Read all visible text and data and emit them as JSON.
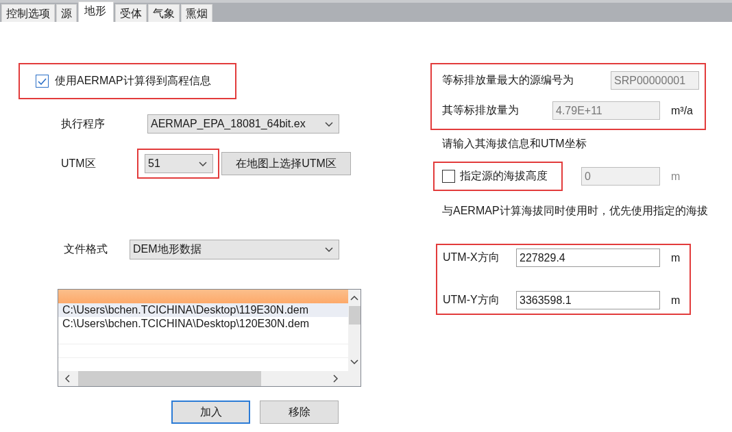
{
  "tabs": [
    {
      "label": "控制选项",
      "selected": false
    },
    {
      "label": "源",
      "selected": false
    },
    {
      "label": "地形",
      "selected": true
    },
    {
      "label": "受体",
      "selected": false
    },
    {
      "label": "气象",
      "selected": false
    },
    {
      "label": "熏烟",
      "selected": false
    }
  ],
  "use_aermap": {
    "label": "使用AERMAP计算得到高程信息",
    "checked": true,
    "highlighted": true
  },
  "executable": {
    "label": "执行程序",
    "value": "AERMAP_EPA_18081_64bit.ex"
  },
  "utm_zone": {
    "label": "UTM区",
    "value": "51",
    "highlighted": true,
    "button": "在地图上选择UTM区"
  },
  "file_format": {
    "label": "文件格式",
    "value": "DEM地形数据"
  },
  "file_list": {
    "rows": [
      {
        "path": "C:\\Users\\bchen.TCICHINA\\Desktop\\119E30N.dem",
        "selected": true
      },
      {
        "path": "C:\\Users\\bchen.TCICHINA\\Desktop\\120E30N.dem",
        "selected": false
      }
    ]
  },
  "list_buttons": [
    {
      "label": "加入",
      "focused": true
    },
    {
      "label": "移除",
      "focused": false
    }
  ],
  "source_info": {
    "highlighted": true,
    "rows": [
      {
        "label": "等标排放量最大的源编号为",
        "value": "SRP00000001"
      },
      {
        "label": "其等标排放量为",
        "value": "4.79E+11",
        "unit": "m³/a"
      }
    ]
  },
  "prompt": "请输入其海拔信息和UTM坐标",
  "specify_elevation": {
    "label": "指定源的海拔高度",
    "checked": false,
    "highlighted": true,
    "value": "0",
    "unit": "m",
    "disabled": true
  },
  "note": "与AERMAP计算海拔同时使用时，优先使用指定的海拔",
  "utm_coords": {
    "highlighted": true,
    "rows": [
      {
        "label": "UTM-X方向",
        "value": "227829.4",
        "unit": "m"
      },
      {
        "label": "UTM-Y方向",
        "value": "3363598.1",
        "unit": "m"
      }
    ]
  }
}
